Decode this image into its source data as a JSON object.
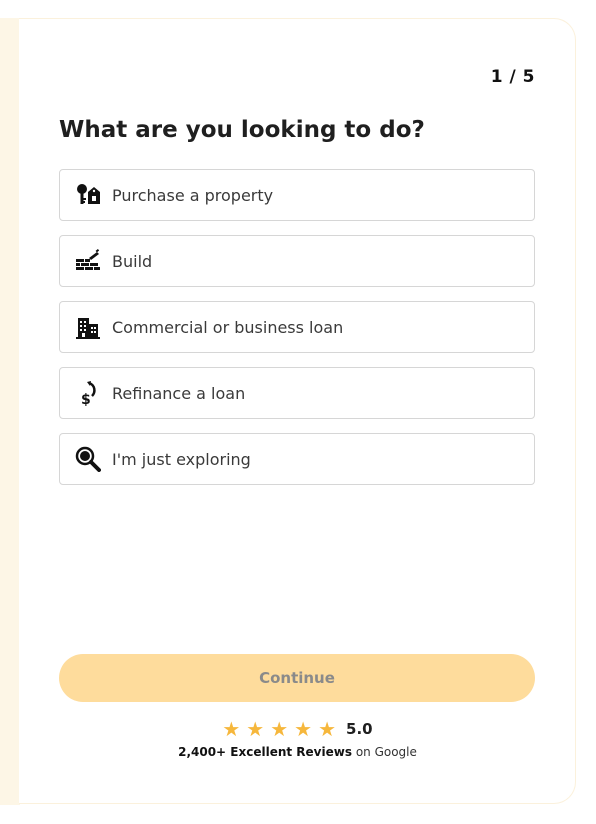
{
  "step_indicator": "1 / 5",
  "question": "What are you looking to do?",
  "options": [
    {
      "label": "Purchase a property",
      "icon": "keys-icon"
    },
    {
      "label": "Build",
      "icon": "brick-trowel-icon"
    },
    {
      "label": "Commercial or business loan",
      "icon": "building-icon"
    },
    {
      "label": "Refinance a loan",
      "icon": "dollar-refresh-icon"
    },
    {
      "label": "I'm just exploring",
      "icon": "magnifier-icon"
    }
  ],
  "continue_label": "Continue",
  "rating": {
    "stars": 5,
    "score": "5.0",
    "reviews_strong": "2,400+ Excellent Reviews",
    "reviews_suffix": "on Google"
  },
  "colors": {
    "accent": "#fedc9c",
    "star": "#f6b73c",
    "side_strip": "#fdf6e6"
  }
}
